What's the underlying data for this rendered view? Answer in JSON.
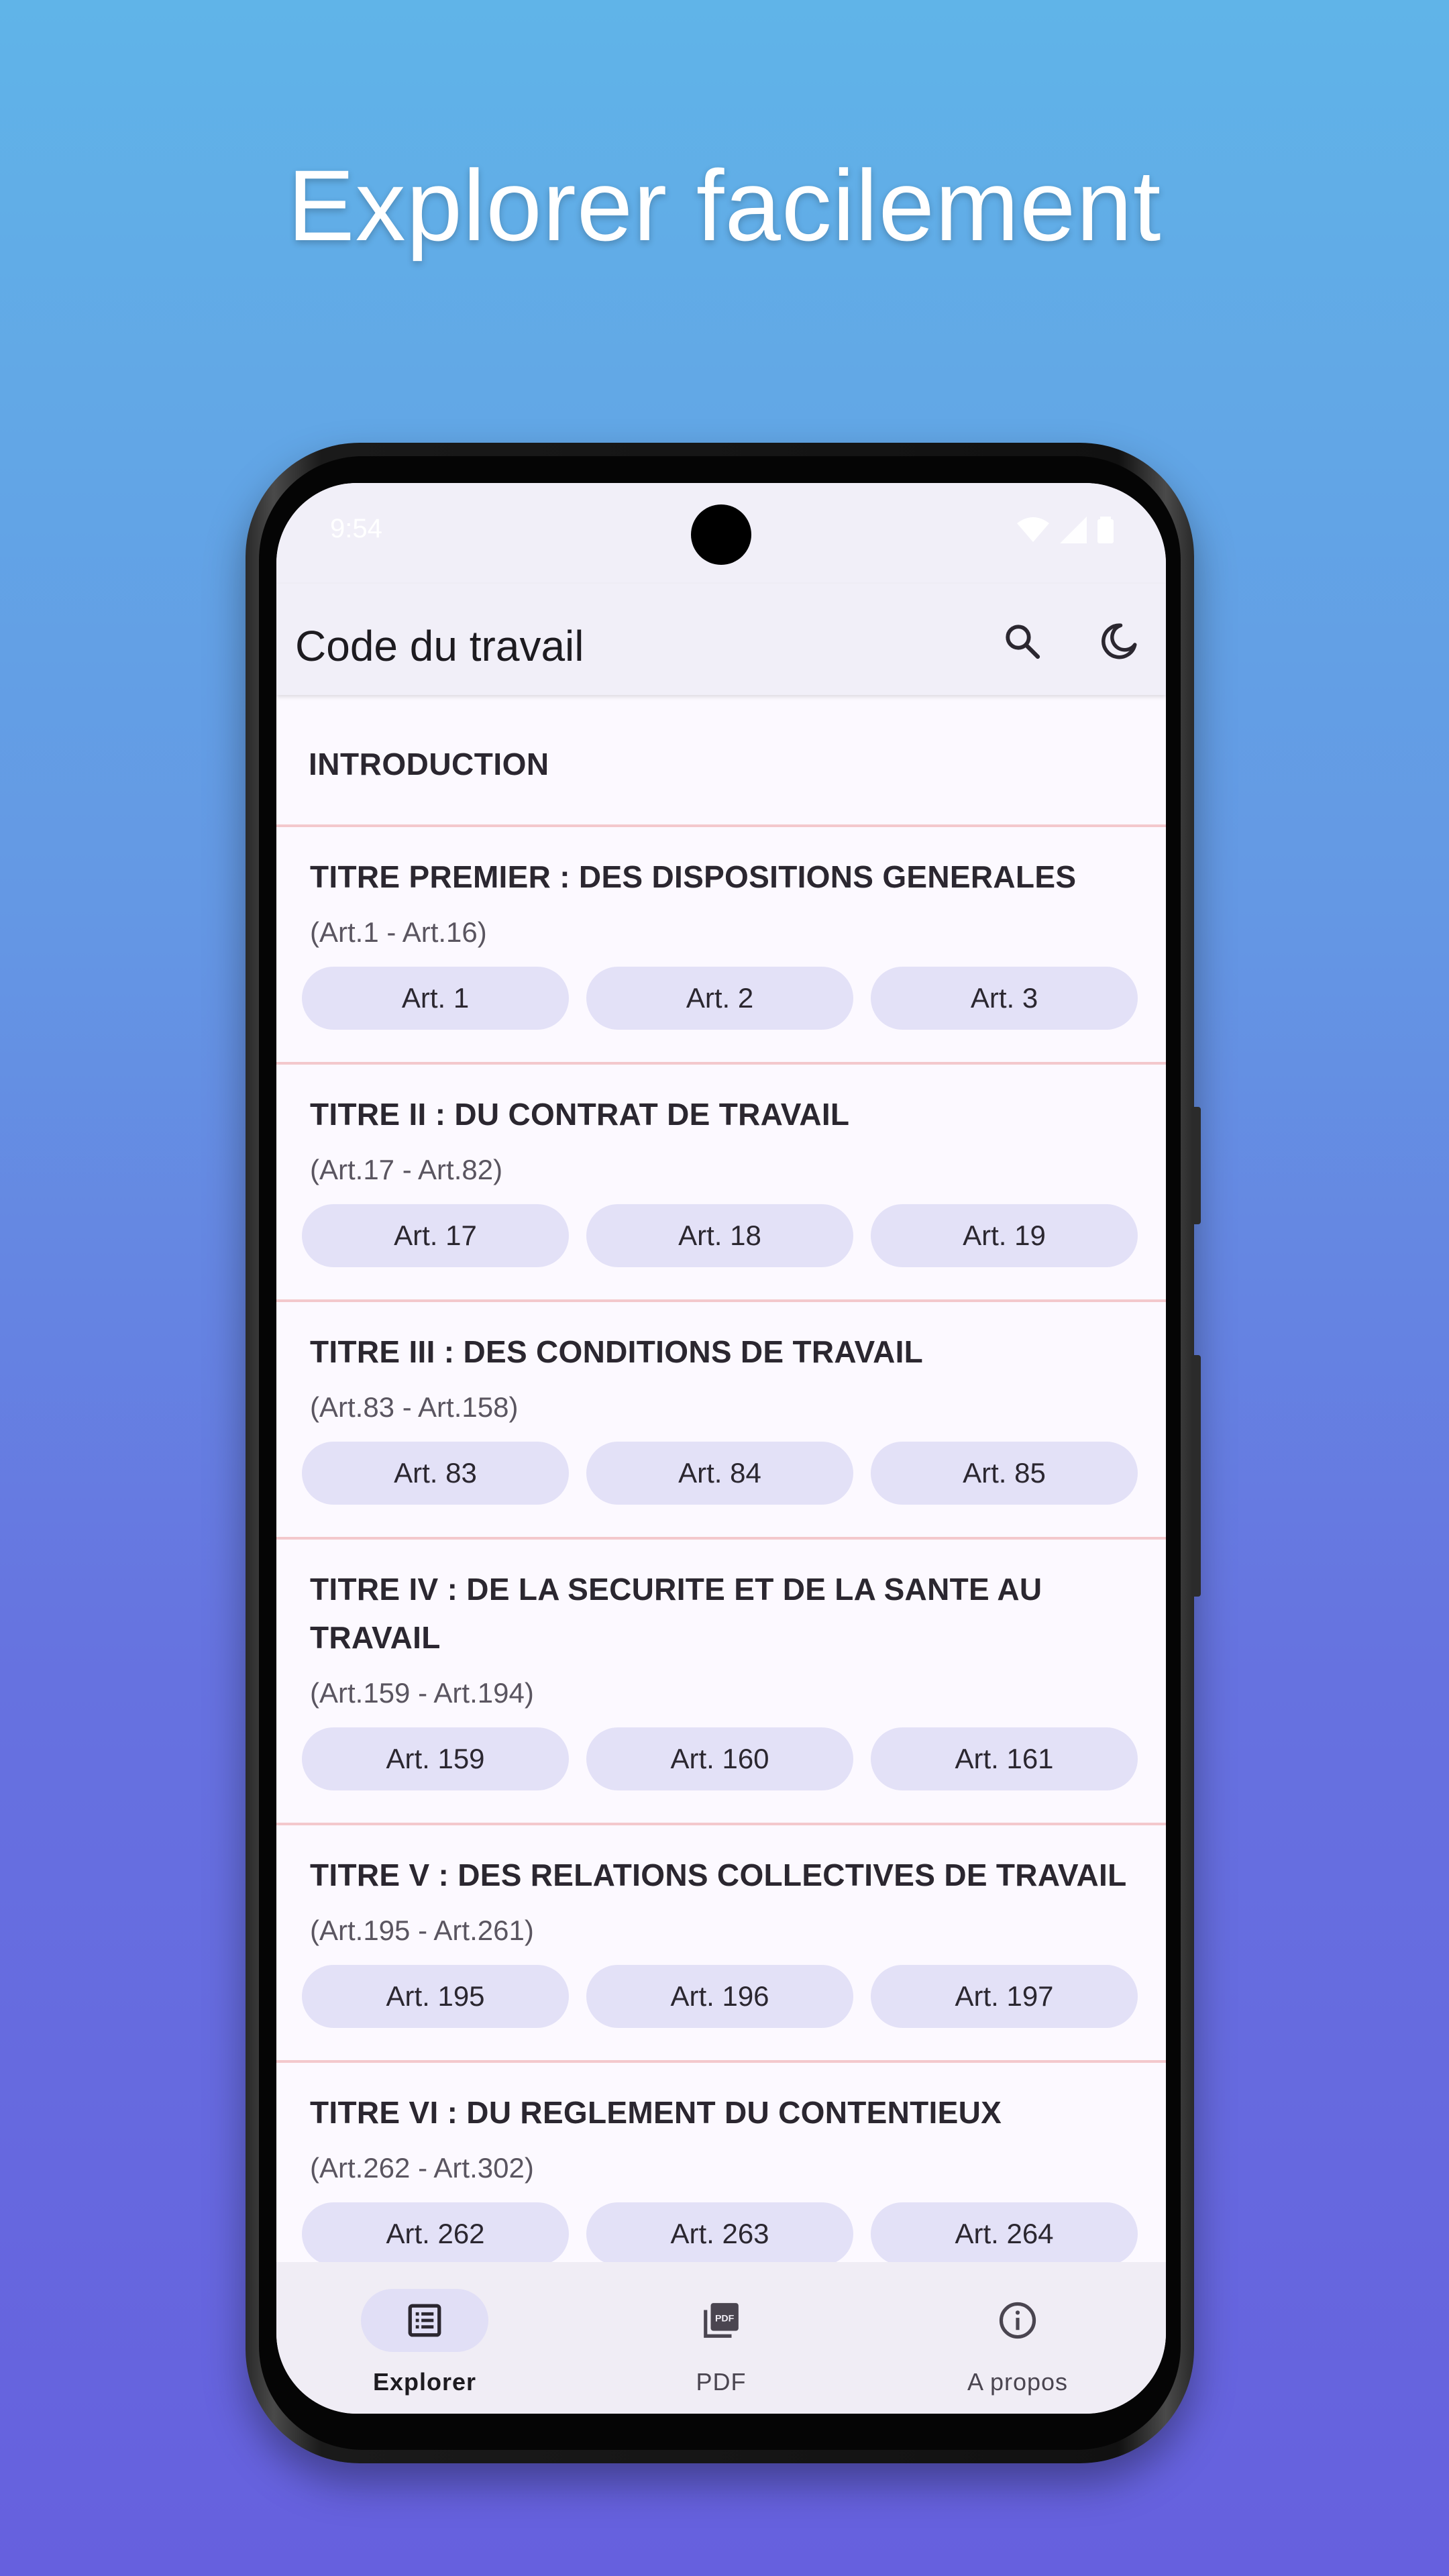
{
  "headline": "Explorer facilement",
  "status_bar": {
    "time": "9:54"
  },
  "app_bar": {
    "title": "Code du travail",
    "actions": [
      "search-icon",
      "moon-icon"
    ]
  },
  "intro": {
    "label": "INTRODUCTION"
  },
  "titres": [
    {
      "name": "TITRE PREMIER : DES DISPOSITIONS GENERALES",
      "range": "(Art.1 - Art.16)",
      "articles": [
        "Art. 1",
        "Art. 2",
        "Art. 3"
      ]
    },
    {
      "name": "TITRE II : DU CONTRAT DE TRAVAIL",
      "range": "(Art.17 - Art.82)",
      "articles": [
        "Art. 17",
        "Art. 18",
        "Art. 19"
      ]
    },
    {
      "name": "TITRE III : DES CONDITIONS DE TRAVAIL",
      "range": "(Art.83 - Art.158)",
      "articles": [
        "Art. 83",
        "Art. 84",
        "Art. 85"
      ]
    },
    {
      "name": "TITRE IV : DE LA SECURITE ET DE LA SANTE AU TRAVAIL",
      "range": "(Art.159 - Art.194)",
      "articles": [
        "Art. 159",
        "Art. 160",
        "Art. 161"
      ]
    },
    {
      "name": "TITRE V : DES RELATIONS COLLECTIVES DE TRAVAIL",
      "range": "(Art.195 - Art.261)",
      "articles": [
        "Art. 195",
        "Art. 196",
        "Art. 197"
      ]
    },
    {
      "name": "TITRE VI : DU REGLEMENT DU CONTENTIEUX",
      "range": "(Art.262 - Art.302)",
      "articles": [
        "Art. 262",
        "Art. 263",
        "Art. 264"
      ]
    }
  ],
  "bottom_nav": [
    {
      "label": "Explorer",
      "icon": "list-icon",
      "active": true
    },
    {
      "label": "PDF",
      "icon": "pdf-icon",
      "active": false
    },
    {
      "label": "A propos",
      "icon": "info-icon",
      "active": false
    }
  ],
  "colors": {
    "accent": "#e3e1f7",
    "divider": "#f3c8cc",
    "background_top": "#60b4e8",
    "background_bottom": "#6660de"
  }
}
